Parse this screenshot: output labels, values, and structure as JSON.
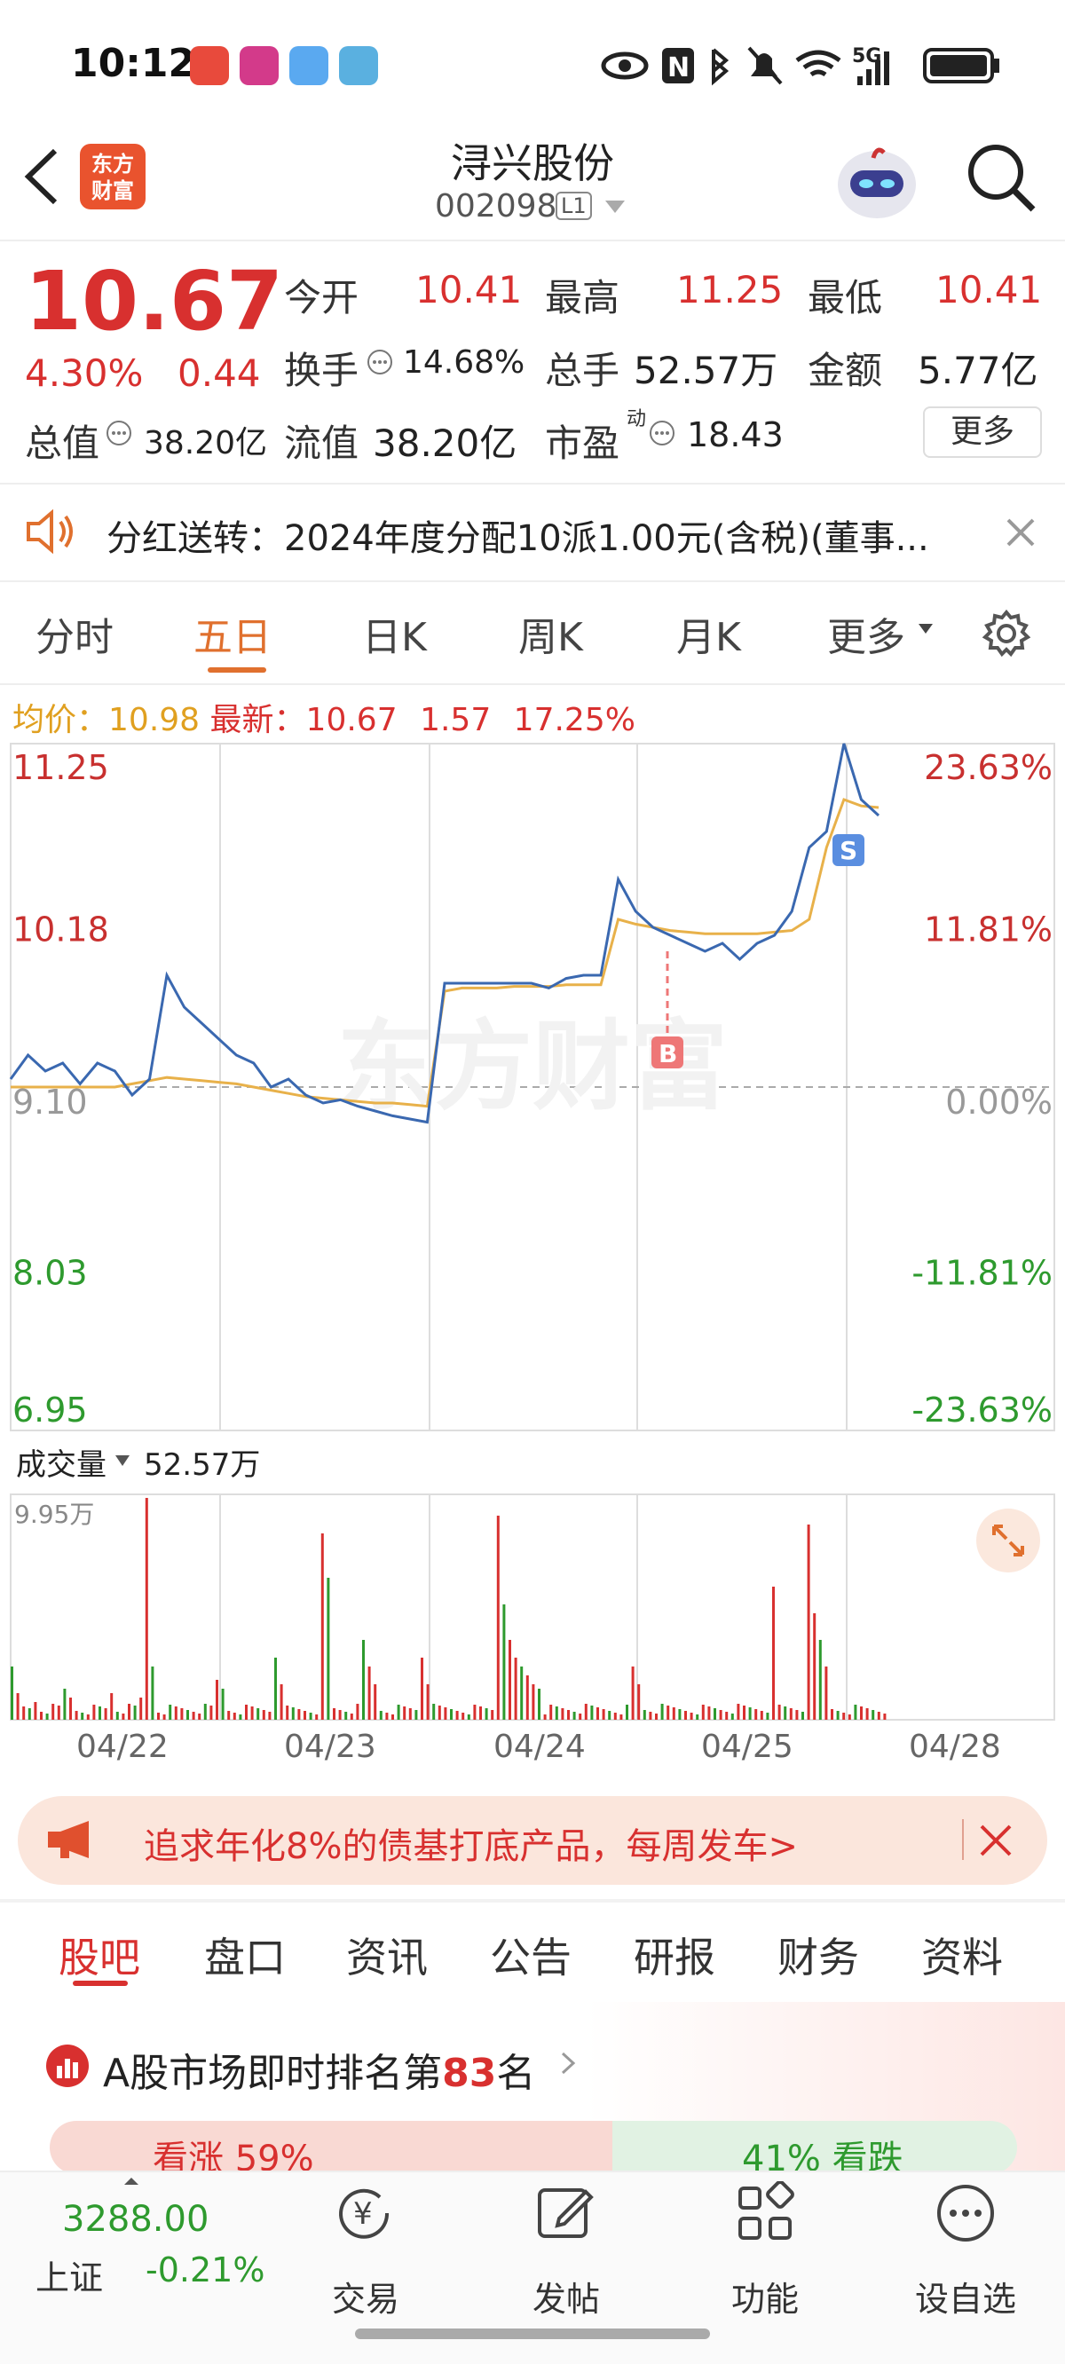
{
  "status": {
    "time": "10:12",
    "signal": "5G",
    "app_icons": [
      "点外卖",
      "电商",
      "优惠",
      "阅读"
    ]
  },
  "header": {
    "title": "浔兴股份",
    "code": "002098",
    "level": "L1",
    "logo_text_1": "东方",
    "logo_text_2": "财富"
  },
  "quote": {
    "price": "10.67",
    "change_pct": "4.30%",
    "change": "0.44",
    "open_label": "今开",
    "open": "10.41",
    "high_label": "最高",
    "high": "11.25",
    "low_label": "最低",
    "low": "10.41",
    "turnover_label": "换手",
    "turnover": "14.68%",
    "volume_label": "总手",
    "volume": "52.57万",
    "amount_label": "金额",
    "amount": "5.77亿",
    "mktcap_label": "总值",
    "mktcap": "38.20亿",
    "float_label": "流值",
    "float": "38.20亿",
    "pe_label": "市盈",
    "pe_sup": "动",
    "pe": "18.43",
    "more": "更多"
  },
  "notice": {
    "text": "分红送转：2024年度分配10派1.00元(含税)(董事..."
  },
  "tabs": {
    "t1": "分时",
    "t2": "五日",
    "t3": "日K",
    "t4": "周K",
    "t5": "月K",
    "t6": "更多"
  },
  "chart_info": {
    "avg_label": "均价：",
    "avg": "10.98",
    "latest_label": "最新：",
    "latest": "10.67",
    "chg": "1.57",
    "chg_pct": "17.25%"
  },
  "chart_data": {
    "type": "line",
    "title": "",
    "x_labels": [
      "04/22",
      "04/23",
      "04/24",
      "04/25",
      "04/28"
    ],
    "y_left": [
      "11.25",
      "10.18",
      "9.10",
      "8.03",
      "6.95"
    ],
    "y_right": [
      "23.63%",
      "11.81%",
      "0.00%",
      "-11.81%",
      "-23.63%"
    ],
    "ylim": [
      6.95,
      11.25
    ],
    "baseline": 9.1,
    "watermark": "东方财富",
    "marker_b": "B",
    "marker_s": "S",
    "series": [
      {
        "values": [
          9.15,
          9.3,
          9.2,
          9.25,
          9.12,
          9.25,
          9.2,
          9.05,
          9.15,
          9.8,
          9.6,
          9.5,
          9.4,
          9.3,
          9.25,
          9.1,
          9.15,
          9.05,
          9.0,
          9.02,
          8.98,
          8.95,
          8.92,
          8.9,
          8.88,
          9.75,
          9.75,
          9.75,
          9.75,
          9.75,
          9.75,
          9.72,
          9.78,
          9.8,
          9.8,
          10.4,
          10.2,
          10.1,
          10.05,
          10.0,
          9.95,
          10.0,
          9.9,
          10.0,
          10.05,
          10.2,
          10.6,
          10.7,
          11.25,
          10.9,
          10.8
        ]
      },
      {
        "values": [
          9.1,
          9.1,
          9.1,
          9.1,
          9.1,
          9.1,
          9.1,
          9.12,
          9.14,
          9.16,
          9.15,
          9.14,
          9.13,
          9.12,
          9.1,
          9.08,
          9.06,
          9.04,
          9.03,
          9.02,
          9.01,
          9.0,
          9.0,
          8.99,
          8.98,
          9.7,
          9.72,
          9.72,
          9.72,
          9.73,
          9.73,
          9.73,
          9.74,
          9.74,
          9.74,
          10.15,
          10.12,
          10.1,
          10.08,
          10.07,
          10.06,
          10.06,
          10.06,
          10.06,
          10.07,
          10.08,
          10.15,
          10.6,
          10.9,
          10.86,
          10.85
        ]
      }
    ]
  },
  "volume": {
    "label": "成交量",
    "value": "52.57万",
    "max": "9.95万"
  },
  "ad": {
    "text": "追求年化8%的债基打底产品，每周发车>"
  },
  "bottom_tabs": [
    "股吧",
    "盘口",
    "资讯",
    "公告",
    "研报",
    "财务",
    "资料"
  ],
  "rank": {
    "prefix": "A股市场即时排名第",
    "num": "83",
    "suffix": "名",
    "up": "看涨 59%",
    "down": "41% 看跌"
  },
  "footer": {
    "index_value": "3288.00",
    "index_name": "上证",
    "index_change": "-0.21%",
    "trade": "交易",
    "post": "发帖",
    "func": "功能",
    "watch": "设自选"
  }
}
